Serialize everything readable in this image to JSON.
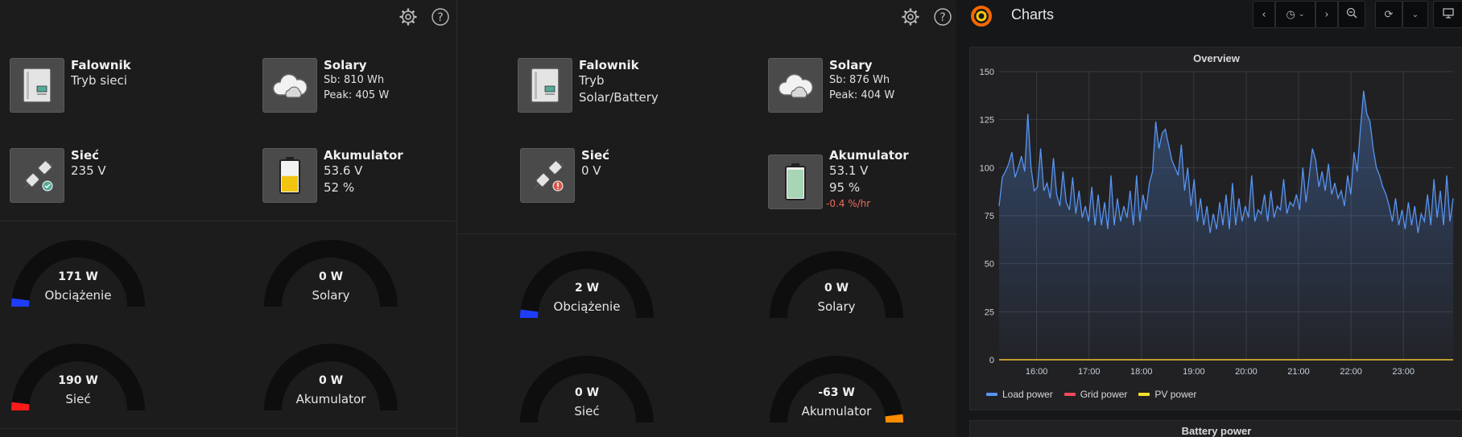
{
  "left_panel": {
    "falownik": {
      "title": "Falownik",
      "line1": "Tryb sieci"
    },
    "solary": {
      "title": "Solary",
      "line1": "Sb: 810 Wh",
      "line2": "Peak: 405 W"
    },
    "siec": {
      "title": "Sieć",
      "line1": "235 V",
      "status": "ok"
    },
    "akumulator": {
      "title": "Akumulator",
      "line1": "53.6 V",
      "line2": "52 %",
      "level": 0.52
    },
    "gauges": [
      {
        "value": "171 W",
        "label": "Obciążenie",
        "fill": 0.04,
        "color": "#1f3dff"
      },
      {
        "value": "0 W",
        "label": "Solary",
        "fill": 0,
        "color": "#1f3dff"
      },
      {
        "value": "190 W",
        "label": "Sieć",
        "fill": 0.04,
        "color": "#ff1a1a"
      },
      {
        "value": "0 W",
        "label": "Akumulator",
        "fill": 0,
        "color": "#1f3dff"
      }
    ]
  },
  "middle_panel": {
    "falownik": {
      "title": "Falownik",
      "line1": "Tryb",
      "line2": "Solar/Battery"
    },
    "solary": {
      "title": "Solary",
      "line1": "Sb: 876 Wh",
      "line2": "Peak: 404 W"
    },
    "siec": {
      "title": "Sieć",
      "line1": "0 V",
      "status": "error"
    },
    "akumulator": {
      "title": "Akumulator",
      "line1": "53.1 V",
      "line2": "95 %",
      "rate": "-0.4 %/hr",
      "level": 0.95
    },
    "gauges": [
      {
        "value": "2 W",
        "label": "Obciążenie",
        "fill": 0.04,
        "color": "#1f3dff"
      },
      {
        "value": "0 W",
        "label": "Solary",
        "fill": 0,
        "color": "#1f3dff"
      },
      {
        "value": "0 W",
        "label": "Sieć",
        "fill": 0,
        "color": "#ff1a1a"
      },
      {
        "value": "-63 W",
        "label": "Akumulator",
        "fill": 0.04,
        "color": "#ff8c00",
        "side": "right"
      }
    ]
  },
  "toolbar_icons": [
    "gear-icon",
    "help-icon"
  ],
  "grafana": {
    "title": "Charts",
    "buttons": [
      "chevron-left-icon",
      "clock-icon",
      "chevron-down-icon",
      "chevron-right-icon",
      "zoom-out-icon",
      "refresh-icon",
      "chevron-down-icon",
      "monitor-icon"
    ],
    "second_panel_title": "Battery power"
  },
  "chart_data": {
    "type": "line",
    "title": "Overview",
    "ylim": [
      0,
      150
    ],
    "yticks": [
      "0",
      "25",
      "50",
      "75",
      "100",
      "125",
      "150"
    ],
    "xticks": [
      "16:00",
      "17:00",
      "18:00",
      "19:00",
      "20:00",
      "21:00",
      "22:00",
      "23:00"
    ],
    "x_range": [
      "15:17",
      "23:57"
    ],
    "grid": true,
    "legend_position": "bottom-left",
    "series": [
      {
        "name": "Load power",
        "color": "#5794f2",
        "fill": true,
        "values": [
          80,
          95,
          98,
          102,
          108,
          95,
          100,
          106,
          98,
          128,
          100,
          88,
          90,
          110,
          88,
          92,
          84,
          105,
          86,
          80,
          98,
          82,
          78,
          95,
          76,
          88,
          74,
          80,
          72,
          90,
          70,
          86,
          70,
          82,
          68,
          96,
          70,
          84,
          72,
          80,
          74,
          88,
          70,
          96,
          72,
          86,
          78,
          92,
          98,
          124,
          110,
          118,
          120,
          112,
          104,
          100,
          96,
          112,
          88,
          100,
          80,
          94,
          72,
          84,
          70,
          80,
          66,
          76,
          68,
          82,
          70,
          86,
          68,
          92,
          70,
          84,
          72,
          80,
          74,
          96,
          72,
          78,
          76,
          86,
          72,
          88,
          74,
          80,
          78,
          94,
          76,
          82,
          80,
          86,
          78,
          100,
          82,
          96,
          110,
          104,
          90,
          98,
          88,
          102,
          86,
          92,
          84,
          88,
          80,
          96,
          86,
          108,
          98,
          120,
          140,
          128,
          124,
          110,
          100,
          96,
          90,
          86,
          80,
          72,
          84,
          70,
          78,
          68,
          82,
          70,
          80,
          66,
          76,
          72,
          86,
          70,
          94,
          74,
          88,
          70,
          96,
          72,
          84
        ]
      },
      {
        "name": "Grid power",
        "color": "#f2495c",
        "fill": false,
        "values": [
          0
        ]
      },
      {
        "name": "PV power",
        "color": "#fade2a",
        "fill": false,
        "values": [
          0
        ]
      }
    ]
  }
}
